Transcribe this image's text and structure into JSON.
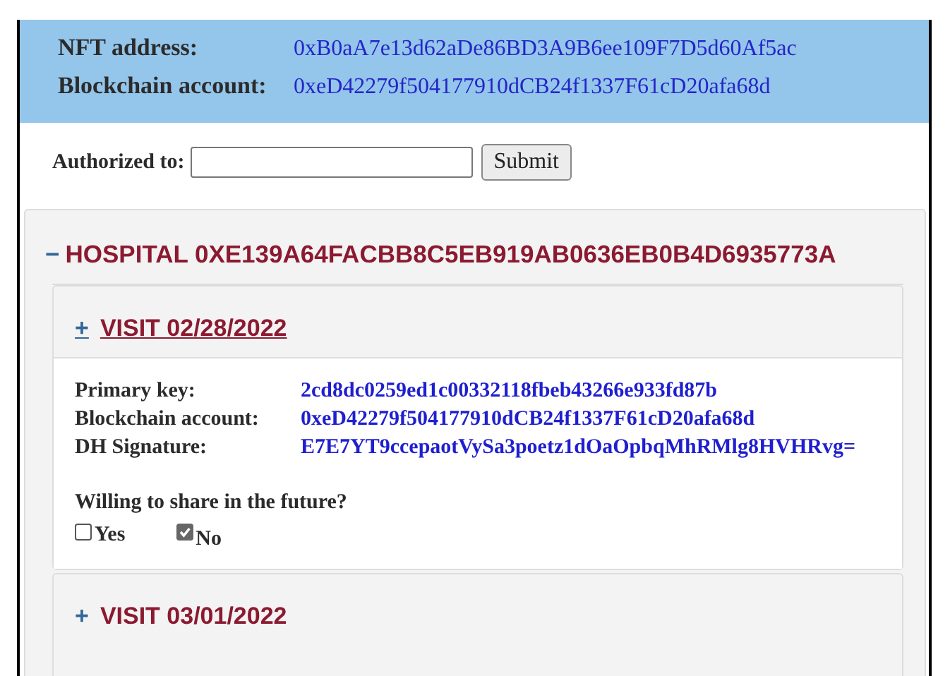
{
  "header": {
    "fields": [
      {
        "label": "NFT address:",
        "value": "0xB0aA7e13d62aDe86BD3A9B6ee109F7D5d60Af5ac"
      },
      {
        "label": "Blockchain account:",
        "value": "0xeD42279f504177910dCB24f1337F61cD20afa68d"
      }
    ]
  },
  "authorize": {
    "label": "Authorized to:",
    "button": "Submit"
  },
  "hospital": {
    "toggle": "−",
    "title": "HOSPITAL 0XE139A64FACBB8C5EB919AB0636EB0B4D6935773A",
    "expanded": true,
    "visits": [
      {
        "toggle": "+",
        "title": "VISIT 02/28/2022",
        "expanded": true,
        "focused": true,
        "details": [
          {
            "label": "Primary key:",
            "value": "2cd8dc0259ed1c00332118fbeb43266e933fd87b"
          },
          {
            "label": "Blockchain account:",
            "value": "0xeD42279f504177910dCB24f1337F61cD20afa68d"
          },
          {
            "label": "DH Signature:",
            "value": "E7E7YT9ccepaotVySa3poetz1dOaOpbqMhRMlg8HVHRvg="
          }
        ],
        "question": "Willing to share in the future?",
        "options": [
          {
            "label": "Yes",
            "checked": false
          },
          {
            "label": "No",
            "checked": true
          }
        ]
      },
      {
        "toggle": "+",
        "title": "VISIT 03/01/2022",
        "expanded": false,
        "focused": false
      }
    ]
  }
}
